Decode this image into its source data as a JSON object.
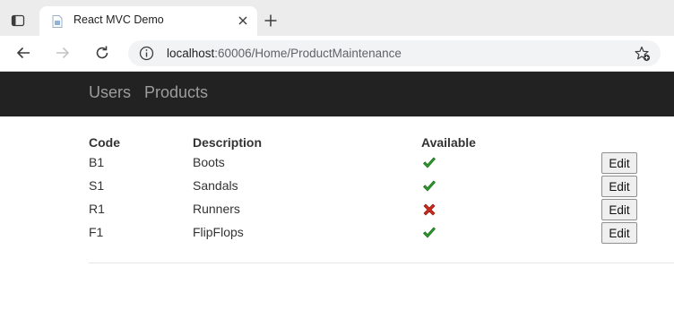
{
  "browser": {
    "tab_title": "React MVC Demo",
    "url_host": "localhost",
    "url_path": ":60006/Home/ProductMaintenance"
  },
  "navbar": {
    "links": [
      {
        "label": "Users"
      },
      {
        "label": "Products"
      }
    ]
  },
  "table": {
    "headers": {
      "code": "Code",
      "description": "Description",
      "available": "Available"
    },
    "rows": [
      {
        "code": "B1",
        "description": "Boots",
        "available": true,
        "action": "Edit"
      },
      {
        "code": "S1",
        "description": "Sandals",
        "available": true,
        "action": "Edit"
      },
      {
        "code": "R1",
        "description": "Runners",
        "available": false,
        "action": "Edit"
      },
      {
        "code": "F1",
        "description": "FlipFlops",
        "available": true,
        "action": "Edit"
      }
    ]
  },
  "icons": {
    "available_true": "check-icon",
    "available_false": "cross-icon"
  },
  "colors": {
    "navbar_bg": "#222222",
    "nav_link": "#9d9d9d",
    "check": "#2e9a2e",
    "cross": "#cc2b1e"
  }
}
